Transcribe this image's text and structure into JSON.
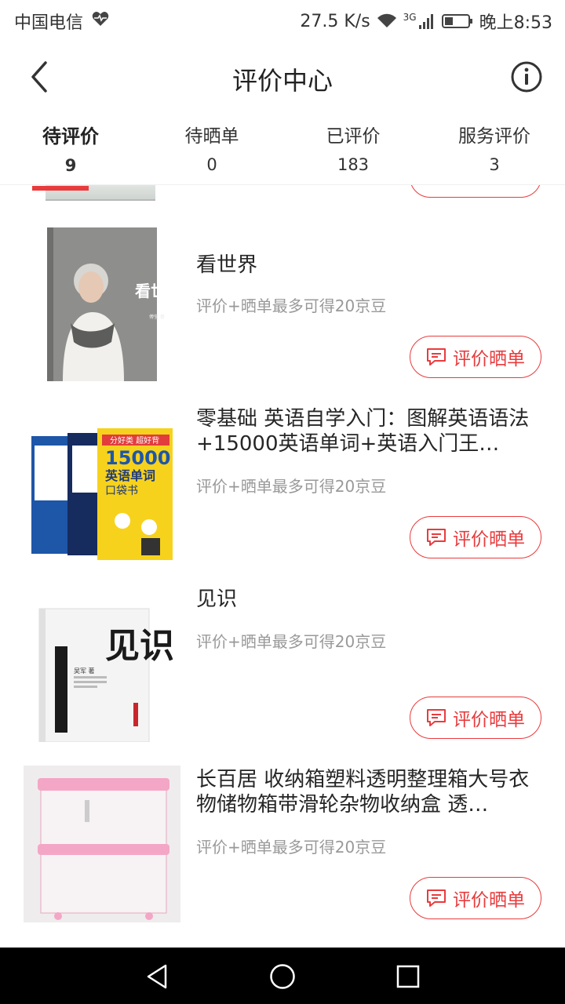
{
  "status_bar": {
    "carrier": "中国电信",
    "net_speed": "27.5 K/s",
    "network_type": "3G",
    "time": "晚上8:53"
  },
  "header": {
    "title": "评价中心",
    "back_icon": "chevron-left-icon",
    "info_icon": "info-circle-icon"
  },
  "tabs": [
    {
      "label": "待评价",
      "count": "9",
      "active": true
    },
    {
      "label": "待晒单",
      "count": "0",
      "active": false
    },
    {
      "label": "已评价",
      "count": "183",
      "active": false
    },
    {
      "label": "服务评价",
      "count": "3",
      "active": false
    }
  ],
  "items": [
    {
      "name": "看世界",
      "hint": "评价+晒单最多可得20京豆",
      "button": "评价晒单",
      "image": "book-cover-kan-shi-jie"
    },
    {
      "name": "零基础 英语自学入门：图解英语语法+15000英语单词+英语入门王…",
      "hint": "评价+晒单最多可得20京豆",
      "button": "评价晒单",
      "image": "english-books-set"
    },
    {
      "name": "见识",
      "hint": "评价+晒单最多可得20京豆",
      "button": "评价晒单",
      "image": "book-cover-jian-shi"
    },
    {
      "name": "长百居 收纳箱塑料透明整理箱大号衣物储物箱带滑轮杂物收纳盒 透…",
      "hint": "评价+晒单最多可得20京豆",
      "button": "评价晒单",
      "image": "plastic-storage-boxes"
    }
  ],
  "book1_cover": {
    "title": "看世界",
    "author": "傅莹 著"
  },
  "book2_cover": {
    "title": "英语单词",
    "number": "15000",
    "subtitle": "口袋书",
    "banner": "分好类 超好背"
  },
  "book3_cover": {
    "title": "见识",
    "author": "吴军 著"
  },
  "colors": {
    "accent": "#e93b3d",
    "hint": "#999999",
    "text": "#262626"
  }
}
